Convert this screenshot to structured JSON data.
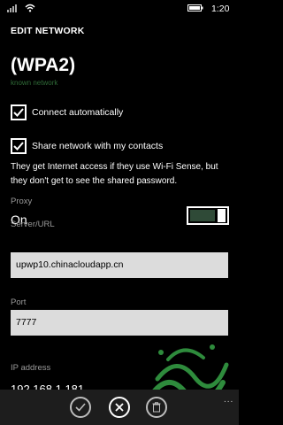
{
  "status_bar": {
    "time": "1:20",
    "icons": [
      "signal-icon",
      "wifi-icon",
      "battery-icon"
    ]
  },
  "page": {
    "header": "EDIT NETWORK",
    "ssid": "(WPA2)",
    "subtitle": "known network"
  },
  "options": {
    "connect_automatically": {
      "label": "Connect automatically",
      "checked": true
    },
    "share_network": {
      "label": "Share network with my contacts",
      "checked": true
    }
  },
  "info_text": "They get Internet access if they use Wi-Fi Sense, but they don't get to see the shared password.",
  "proxy": {
    "label": "Proxy",
    "value": "On",
    "enabled": true
  },
  "server": {
    "label": "Server/URL",
    "value": "upwp10.chinacloudapp.cn"
  },
  "port": {
    "label": "Port",
    "value": "7777"
  },
  "ip": {
    "label": "IP address",
    "value": "192.168.1.181"
  },
  "appbar": {
    "buttons": [
      {
        "icon": "checkmark-icon",
        "action": "save"
      },
      {
        "icon": "close-icon",
        "action": "cancel"
      },
      {
        "icon": "trash-icon",
        "action": "delete"
      }
    ],
    "more": "..."
  },
  "colors": {
    "background": "#000000",
    "accent": "#2f4a37",
    "subtitle": "#2f6a37",
    "input_bg": "#dcdcdc",
    "appbar_bg": "#1d1d1d"
  }
}
